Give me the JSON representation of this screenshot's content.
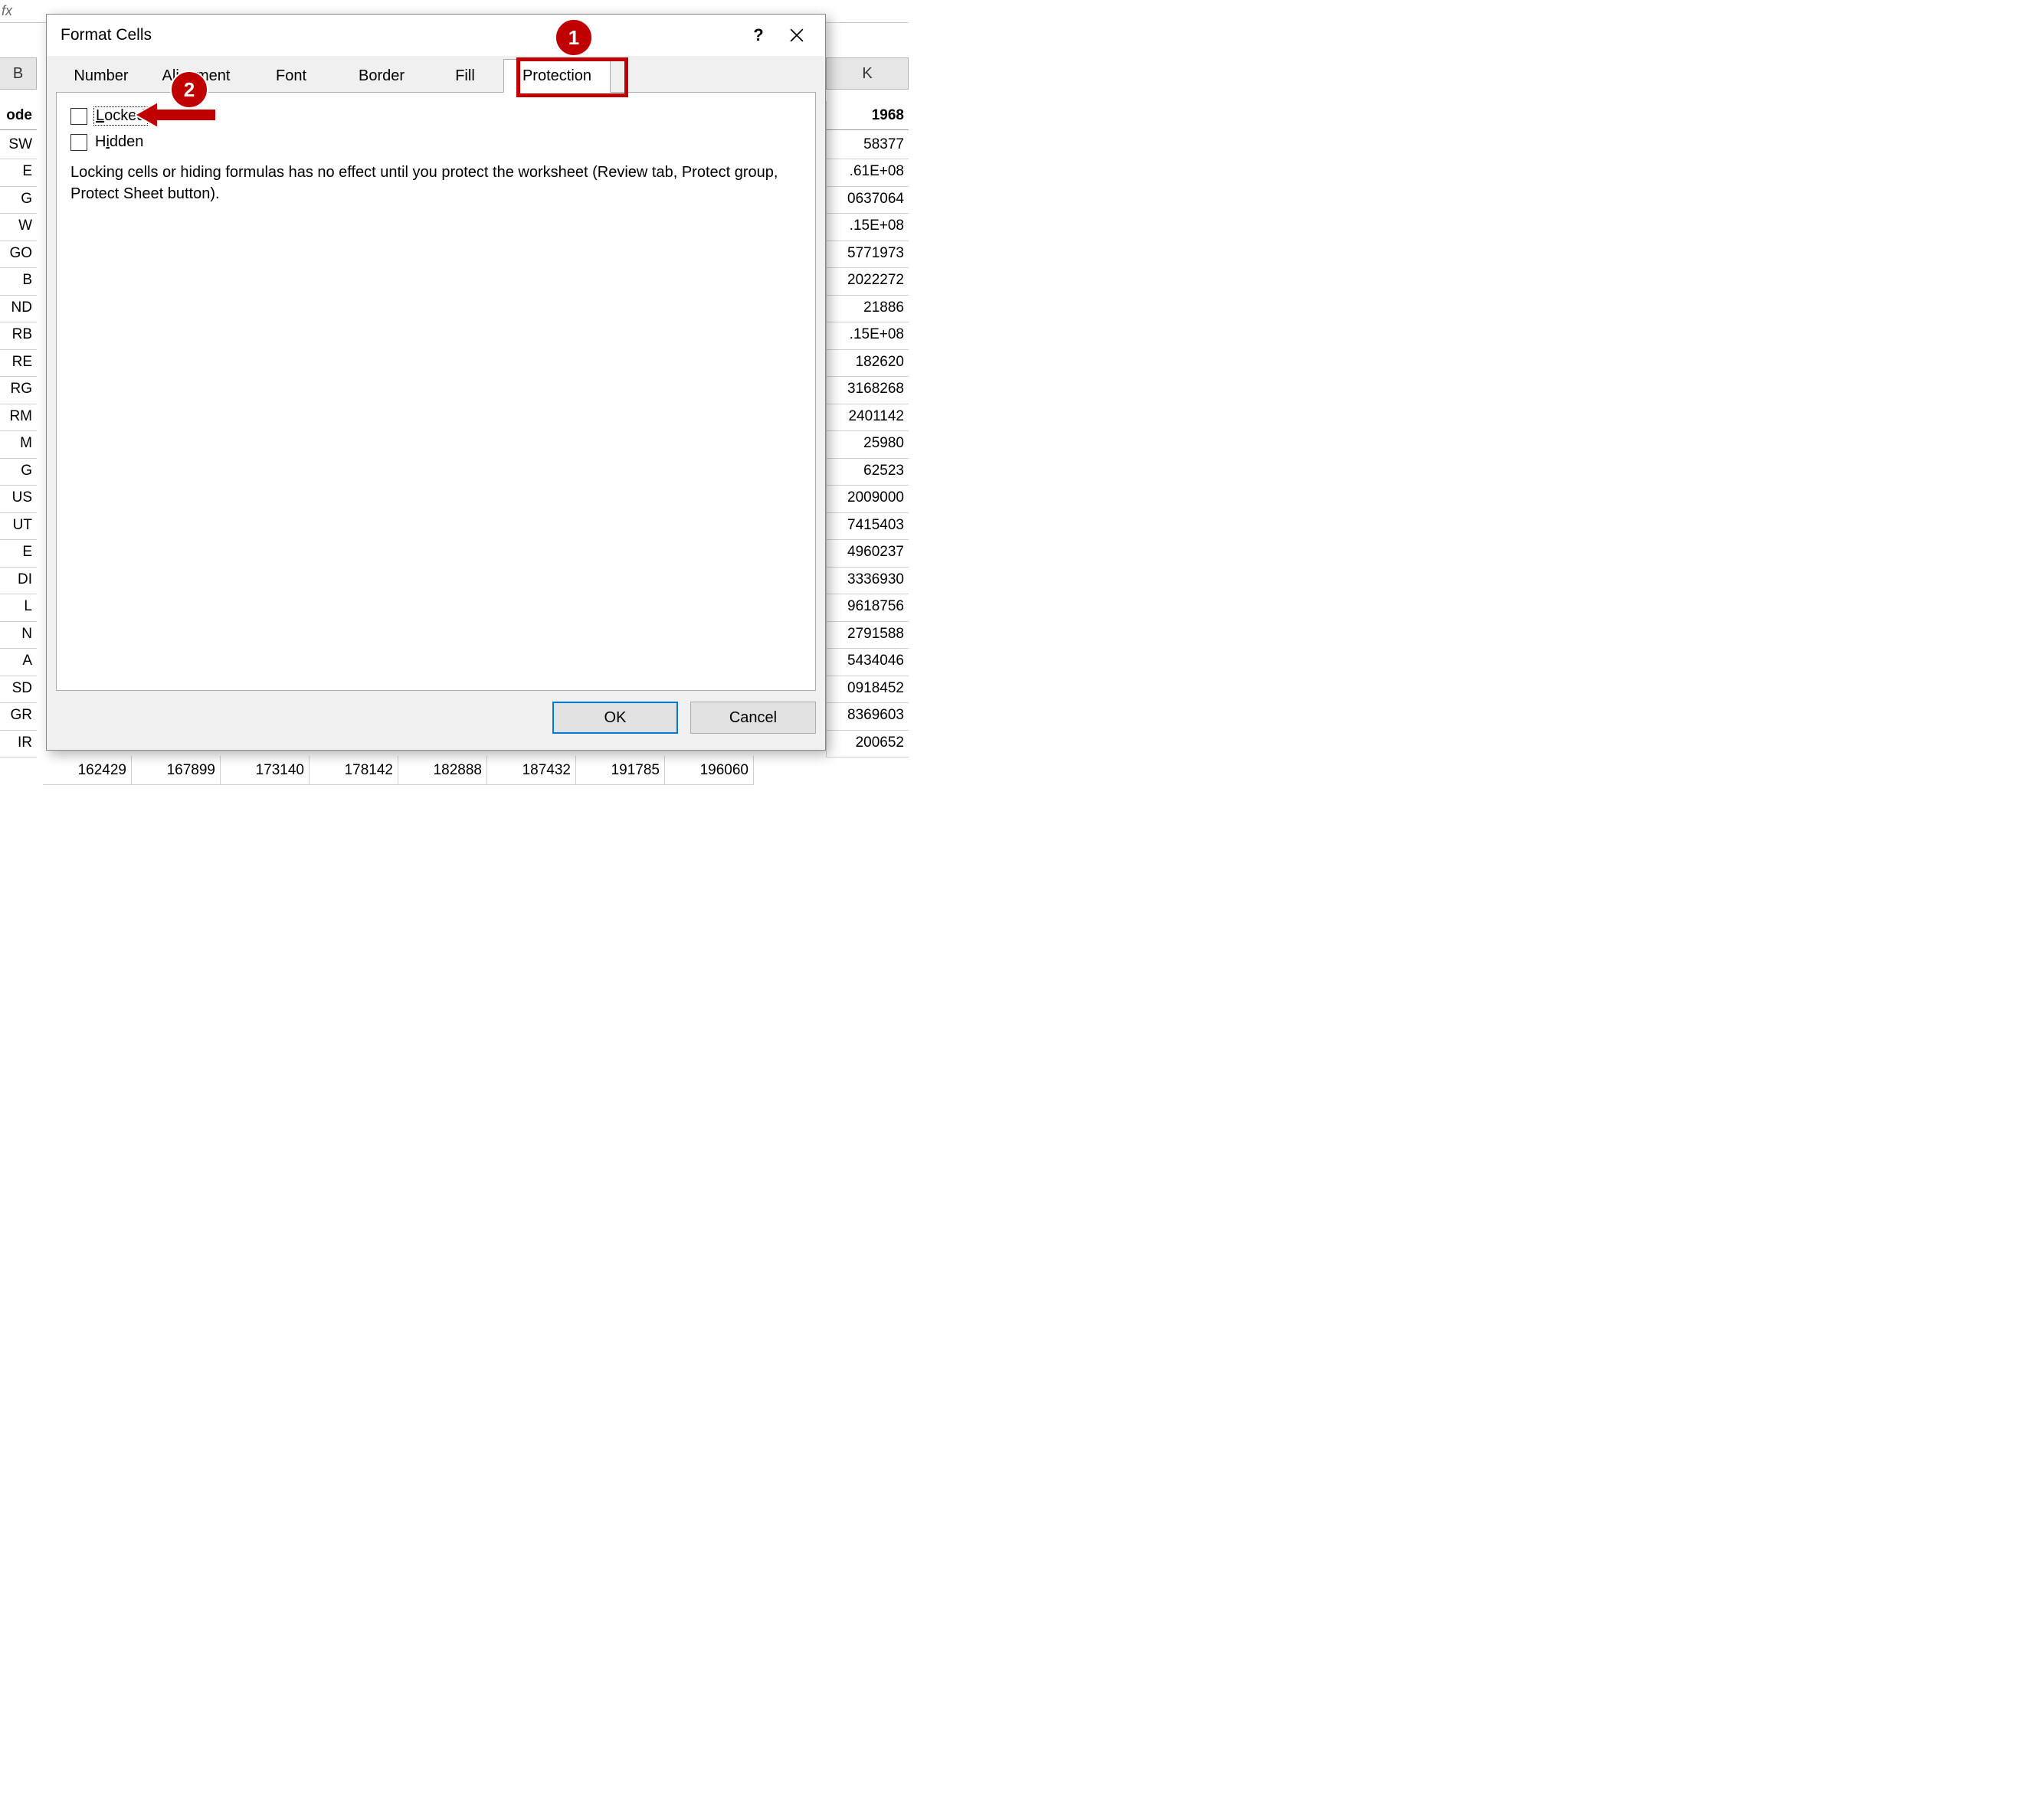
{
  "fx_label": "fx",
  "columns": {
    "left": "B",
    "right": "K"
  },
  "header_row": {
    "left": "ode",
    "right": "1968"
  },
  "rows_left": [
    "SW",
    "E",
    "G",
    "W",
    "GO",
    "B",
    "ND",
    "RB",
    "RE",
    "RG",
    "RM",
    "M",
    "G",
    "US",
    "UT",
    "E",
    "DI",
    "L",
    "N",
    "A",
    "SD",
    "GR",
    "IR"
  ],
  "rows_right": [
    "58377",
    ".61E+08",
    "0637064",
    ".15E+08",
    "5771973",
    "2022272",
    "21886",
    ".15E+08",
    "182620",
    "3168268",
    "2401142",
    "25980",
    "62523",
    "2009000",
    "7415403",
    "4960237",
    "3336930",
    "9618756",
    "2791588",
    "5434046",
    "0918452",
    "8369603",
    "200652"
  ],
  "bottom_numbers": [
    "162429",
    "167899",
    "173140",
    "178142",
    "182888",
    "187432",
    "191785",
    "196060"
  ],
  "dialog": {
    "title": "Format Cells",
    "tabs": [
      "Number",
      "Alignment",
      "Font",
      "Border",
      "Fill",
      "Protection"
    ],
    "active_tab": "Protection",
    "locked_label": "Locked",
    "hidden_label": "Hidden",
    "description": "Locking cells or hiding formulas has no effect until you protect the worksheet (Review tab, Protect group, Protect Sheet button).",
    "ok": "OK",
    "cancel": "Cancel"
  },
  "annotations": {
    "badge1": "1",
    "badge2": "2"
  }
}
